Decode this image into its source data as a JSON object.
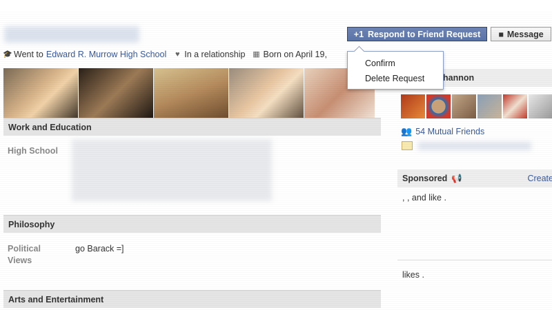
{
  "header": {
    "info": {
      "went_to_prefix": "Went to",
      "school_link": "Edward R. Murrow High School",
      "relationship": "In a relationship",
      "born": "Born on April 19,"
    },
    "respond_button": "Respond to Friend Request",
    "message_button": "Message",
    "dropdown": {
      "confirm": "Confirm",
      "delete": "Delete Request"
    }
  },
  "sections": {
    "work_education": "Work and Education",
    "high_school_label": "High School",
    "philosophy": "Philosophy",
    "political_label_line1": "Political",
    "political_label_line2": "Views",
    "political_value": "go Barack =]",
    "arts": "Arts and Entertainment"
  },
  "sidebar": {
    "friend_name_partial": "hannon",
    "mutual_friends": "54 Mutual Friends",
    "sponsored": "Sponsored",
    "create": "Create",
    "likes_line1": ", , and like .",
    "likes_line2": "likes ."
  },
  "icons": {
    "school": "graduation-cap-icon",
    "heart": "heart-icon",
    "calendar": "calendar-icon",
    "add_friend": "add-friend-icon",
    "message": "speech-bubble-icon",
    "friends": "friends-icon",
    "megaphone": "megaphone-icon"
  },
  "colors": {
    "link": "#3b5998",
    "button_blue": "#5b74a8",
    "section_bg": "#e5e5e5"
  }
}
